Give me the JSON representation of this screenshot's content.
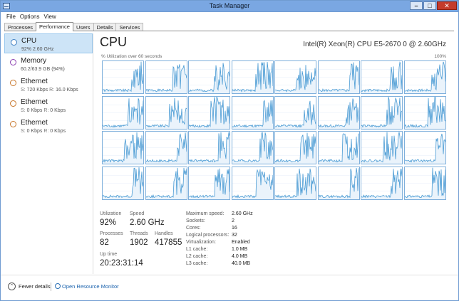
{
  "window": {
    "title": "Task Manager"
  },
  "menu": [
    "File",
    "Options",
    "View"
  ],
  "tabs": [
    "Processes",
    "Performance",
    "Users",
    "Details",
    "Services"
  ],
  "active_tab": "Performance",
  "sidebar": {
    "items": [
      {
        "title": "CPU",
        "sub": "92% 2.60 GHz"
      },
      {
        "title": "Memory",
        "sub": "60.2/63.9 GB (94%)"
      },
      {
        "title": "Ethernet",
        "sub_s": "720 Kbps",
        "sub_r": "16.0 Kbps"
      },
      {
        "title": "Ethernet",
        "sub_s": "0 Kbps",
        "sub_r": "0 Kbps"
      },
      {
        "title": "Ethernet",
        "sub_s": "0 Kbps",
        "sub_r": "0 Kbps"
      }
    ],
    "s_label": "S:",
    "r_label": "R:"
  },
  "main": {
    "title": "CPU",
    "cpu_name": "Intel(R) Xeon(R) CPU E5-2670 0 @ 2.60GHz",
    "util_label": "% Utilization over 60 seconds",
    "util_max": "100%",
    "graph_count": 32
  },
  "stats": {
    "utilization_label": "Utilization",
    "utilization": "92%",
    "speed_label": "Speed",
    "speed": "2.60 GHz",
    "processes_label": "Processes",
    "processes": "82",
    "threads_label": "Threads",
    "threads": "1902",
    "handles_label": "Handles",
    "handles": "417855",
    "uptime_label": "Up time",
    "uptime": "20:23:31:14"
  },
  "specs": [
    {
      "key": "Maximum speed:",
      "value": "2.60 GHz"
    },
    {
      "key": "Sockets:",
      "value": "2"
    },
    {
      "key": "Cores:",
      "value": "16"
    },
    {
      "key": "Logical processors:",
      "value": "32"
    },
    {
      "key": "Virtualization:",
      "value": "Enabled"
    },
    {
      "key": "L1 cache:",
      "value": "1.0 MB"
    },
    {
      "key": "L2 cache:",
      "value": "4.0 MB"
    },
    {
      "key": "L3 cache:",
      "value": "40.0 MB"
    }
  ],
  "footer": {
    "fewer_details": "Fewer details",
    "open_monitor": "Open Resource Monitor"
  },
  "colors": {
    "accent": "#3f7fc0",
    "graph_line": "#4a9bd4",
    "graph_border": "#7fb0dc",
    "selected_bg": "#cde4f7",
    "link": "#1a62ad"
  }
}
